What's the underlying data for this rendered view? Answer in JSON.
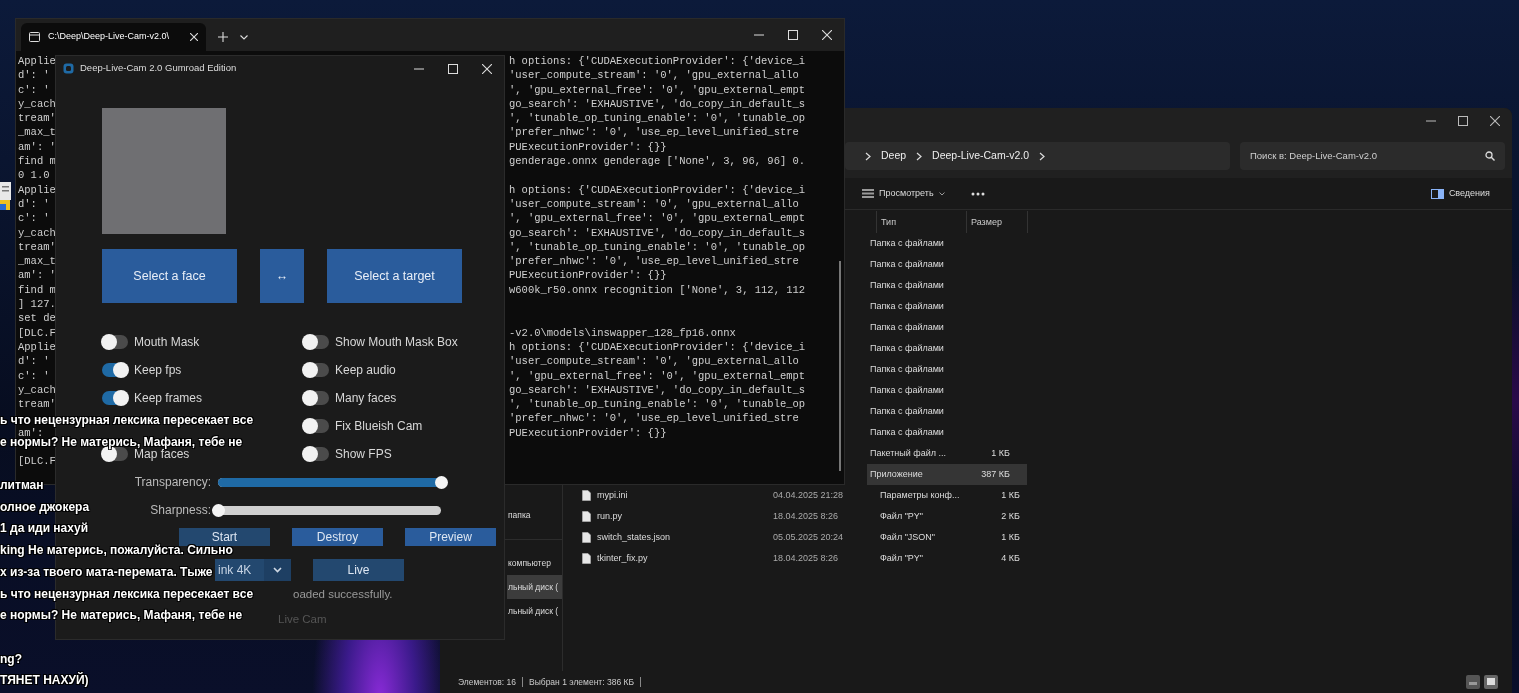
{
  "terminal": {
    "tab_title": "C:\\Deep\\Deep-Live-Cam-v2.0\\",
    "lines": [
      {
        "kind": "text",
        "left": "Applie",
        "right": "h options: {'CUDAExecutionProvider': {'device_i"
      },
      {
        "kind": "text",
        "left": "d': '",
        "right": "'user_compute_stream': '0', 'gpu_external_allo"
      },
      {
        "kind": "text",
        "left": "c': '",
        "right": "', 'gpu_external_free': '0', 'gpu_external_empt"
      },
      {
        "kind": "text",
        "left": "y_cach",
        "right": "go_search': 'EXHAUSTIVE', 'do_copy_in_default_s"
      },
      {
        "kind": "text",
        "left": "tream'",
        "right": "', 'tunable_op_tuning_enable': '0', 'tunable_op"
      },
      {
        "kind": "text",
        "left": "_max_t",
        "right": "'prefer_nhwc': '0', 'use_ep_level_unified_stre"
      },
      {
        "kind": "text",
        "left": "am': '",
        "right": "PUExecutionProvider': {}}"
      },
      {
        "kind": "text",
        "left": "find m",
        "right": "genderage.onnx genderage ['None', 3, 96, 96] 0."
      },
      {
        "kind": "text",
        "left": "0 1.0"
      },
      {
        "kind": "text",
        "left": "Applie",
        "right": "h options: {'CUDAExecutionProvider': {'device_i"
      },
      {
        "kind": "text",
        "left": "d': '",
        "right": "'user_compute_stream': '0', 'gpu_external_allo"
      },
      {
        "kind": "text",
        "left": "c': '",
        "right": "', 'gpu_external_free': '0', 'gpu_external_empt"
      },
      {
        "kind": "text",
        "left": "y_cach",
        "right": "go_search': 'EXHAUSTIVE', 'do_copy_in_default_s"
      },
      {
        "kind": "text",
        "left": "tream'",
        "right": "', 'tunable_op_tuning_enable': '0', 'tunable_op"
      },
      {
        "kind": "text",
        "left": "_max_t",
        "right": "'prefer_nhwc': '0', 'use_ep_level_unified_stre"
      },
      {
        "kind": "text",
        "left": "am': '",
        "right": "PUExecutionProvider': {}}"
      },
      {
        "kind": "text",
        "left": "find m",
        "right": "w600k_r50.onnx recognition ['None', 3, 112, 112"
      },
      {
        "kind": "text",
        "left": "] 127."
      },
      {
        "kind": "text",
        "left": "set de"
      },
      {
        "kind": "text",
        "left": "[DLC.F",
        "right": "-v2.0\\models\\inswapper_128_fp16.onnx"
      },
      {
        "kind": "text",
        "left": "Applie",
        "right": "h options: {'CUDAExecutionProvider': {'device_i"
      },
      {
        "kind": "text",
        "left": "d': '",
        "right": "'user_compute_stream': '0', 'gpu_external_allo"
      },
      {
        "kind": "text",
        "left": "c': '",
        "right": "', 'gpu_external_free': '0', 'gpu_external_empt"
      },
      {
        "kind": "text",
        "left": "y_cach",
        "right": "go_search': 'EXHAUSTIVE', 'do_copy_in_default_s"
      },
      {
        "kind": "text",
        "left": "tream'",
        "right": "', 'tunable_op_tuning_enable': '0', 'tunable_op"
      },
      {
        "kind": "text",
        "right": "'prefer_nhwc': '0', 'use_ep_level_unified_stre"
      },
      {
        "kind": "text",
        "left": "am':",
        "right": "PUExecutionProvider': {}}"
      },
      {
        "kind": "blank"
      },
      {
        "kind": "text",
        "left": "[DLC.F"
      }
    ]
  },
  "explorer": {
    "breadcrumb": [
      "Deep",
      "Deep-Live-Cam-v2.0"
    ],
    "search": {
      "placeholder": "Поиск в: Deep-Live-Cam-v2.0"
    },
    "toolbar": {
      "view": "Просмотреть",
      "details": "Сведения"
    },
    "columns": [
      "Тип",
      "Размер"
    ],
    "nav_groups": [
      [
        {
          "label": "папка",
          "selected": false
        }
      ],
      [
        {
          "label": "компьютер",
          "selected": false
        },
        {
          "label": "льный диск (",
          "selected": true
        },
        {
          "label": "льный диск (",
          "selected": false
        }
      ]
    ],
    "rows": [
      {
        "type": "Папка с файлами",
        "selected": false
      },
      {
        "type": "Папка с файлами",
        "selected": false
      },
      {
        "type": "Папка с файлами",
        "selected": false
      },
      {
        "type": "Папка с файлами",
        "selected": false
      },
      {
        "type": "Папка с файлами",
        "selected": false
      },
      {
        "type": "Папка с файлами",
        "selected": false
      },
      {
        "type": "Папка с файлами",
        "selected": false
      },
      {
        "type": "Папка с файлами",
        "selected": false
      },
      {
        "type": "Папка с файлами",
        "selected": false
      },
      {
        "type": "Папка с файлами",
        "selected": false
      },
      {
        "type": "Пакетный файл ...",
        "size": "1 КБ",
        "selected": false
      },
      {
        "type": "Приложение",
        "size": "387 КБ",
        "selected": true
      },
      {
        "name": "mypi.ini",
        "date": "04.04.2025 21:28",
        "type": "Параметры конф...",
        "size": "1 КБ",
        "selected": false
      },
      {
        "name": "run.py",
        "date": "18.04.2025 8:26",
        "type": "Файл \"PY\"",
        "size": "2 КБ",
        "selected": false
      },
      {
        "name": "switch_states.json",
        "date": "05.05.2025 20:24",
        "type": "Файл \"JSON\"",
        "size": "1 КБ",
        "selected": false
      },
      {
        "name": "tkinter_fix.py",
        "date": "18.04.2025 8:26",
        "type": "Файл \"PY\"",
        "size": "4 КБ",
        "selected": false
      }
    ],
    "status": [
      "Элементов: 16",
      "Выбран 1 элемент: 386 КБ"
    ]
  },
  "app": {
    "title": "Deep-Live-Cam 2.0 Gumroad Edition",
    "face_button": "Select a face",
    "swap_button": "↔",
    "target_button": "Select a target",
    "toggles_left": [
      {
        "kind": "toggle",
        "label": "Mouth Mask",
        "on": false
      },
      {
        "kind": "toggle",
        "label": "Keep fps",
        "on": true
      },
      {
        "kind": "toggle",
        "label": "Keep frames",
        "on": true
      },
      {
        "kind": "covered"
      },
      {
        "kind": "toggle",
        "label": "Map faces",
        "on": false
      }
    ],
    "toggles_right": [
      {
        "kind": "toggle",
        "label": "Show Mouth Mask Box",
        "on": false
      },
      {
        "kind": "toggle",
        "label": "Keep audio",
        "on": false
      },
      {
        "kind": "toggle",
        "label": "Many faces",
        "on": false
      },
      {
        "kind": "toggle",
        "label": "Fix Blueish Cam",
        "on": false
      },
      {
        "kind": "toggle",
        "label": "Show FPS",
        "on": false
      }
    ],
    "sliders": [
      {
        "label": "Transparency:",
        "level": 1
      },
      {
        "label": "Sharpness:",
        "level": 0
      }
    ],
    "actions": [
      "Start",
      "Destroy",
      "Preview"
    ],
    "camera": {
      "value": "ink 4K"
    },
    "live_button": "Live",
    "status": "oaded successfully.",
    "footer": "Live Cam"
  },
  "chat": {
    "blocks": [
      [
        "ь что нецензурная лексика пересекает все",
        "е нормы? Не матерись, Мафаня, тебе не"
      ],
      [
        "литман",
        "олное джокера",
        "1 да иди нахуй",
        "king Не матерись, пожалуйста. Сильно",
        "х из-за твоего мата-перемата. Тыже",
        "ь что нецензурная лексика пересекает все",
        "е нормы? Не матерись, Мафаня, тебе не"
      ],
      [
        "ng?",
        "ТЯНЕТ НАХУЙ)"
      ]
    ]
  }
}
